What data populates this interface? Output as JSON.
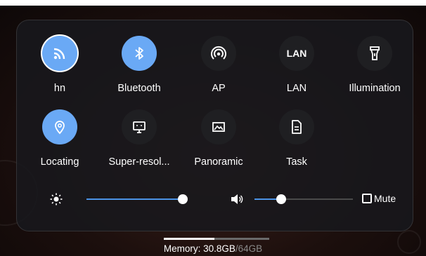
{
  "tiles_row1": [
    {
      "label": "hn",
      "icon": "wifi-icon",
      "state": "active"
    },
    {
      "label": "Bluetooth",
      "icon": "bluetooth-icon",
      "state": "active"
    },
    {
      "label": "AP",
      "icon": "hotspot-icon",
      "state": "inactive"
    },
    {
      "label": "LAN",
      "icon": "lan-icon",
      "icon_text": "LAN",
      "state": "inactive"
    },
    {
      "label": "Illumination",
      "icon": "flashlight-icon",
      "state": "inactive"
    }
  ],
  "tiles_row2": [
    {
      "label": "Locating",
      "icon": "location-icon",
      "state": "active"
    },
    {
      "label": "Super-resol...",
      "icon": "monitor-icon",
      "state": "inactive"
    },
    {
      "label": "Panoramic",
      "icon": "panorama-icon",
      "state": "inactive"
    },
    {
      "label": "Task",
      "icon": "document-icon",
      "state": "inactive"
    }
  ],
  "brightness": {
    "icon": "brightness-icon",
    "level": 0.98
  },
  "volume": {
    "icon": "speaker-icon",
    "level": 0.27
  },
  "mute": {
    "label": "Mute",
    "checked": false
  },
  "memory": {
    "prefix": "Memory: ",
    "used": "30.8GB",
    "total": "/64GB",
    "used_fraction": 0.48
  },
  "colors": {
    "accent": "#6aa9f5",
    "slider_fill": "#4b93e6",
    "panel": "#18181c"
  }
}
